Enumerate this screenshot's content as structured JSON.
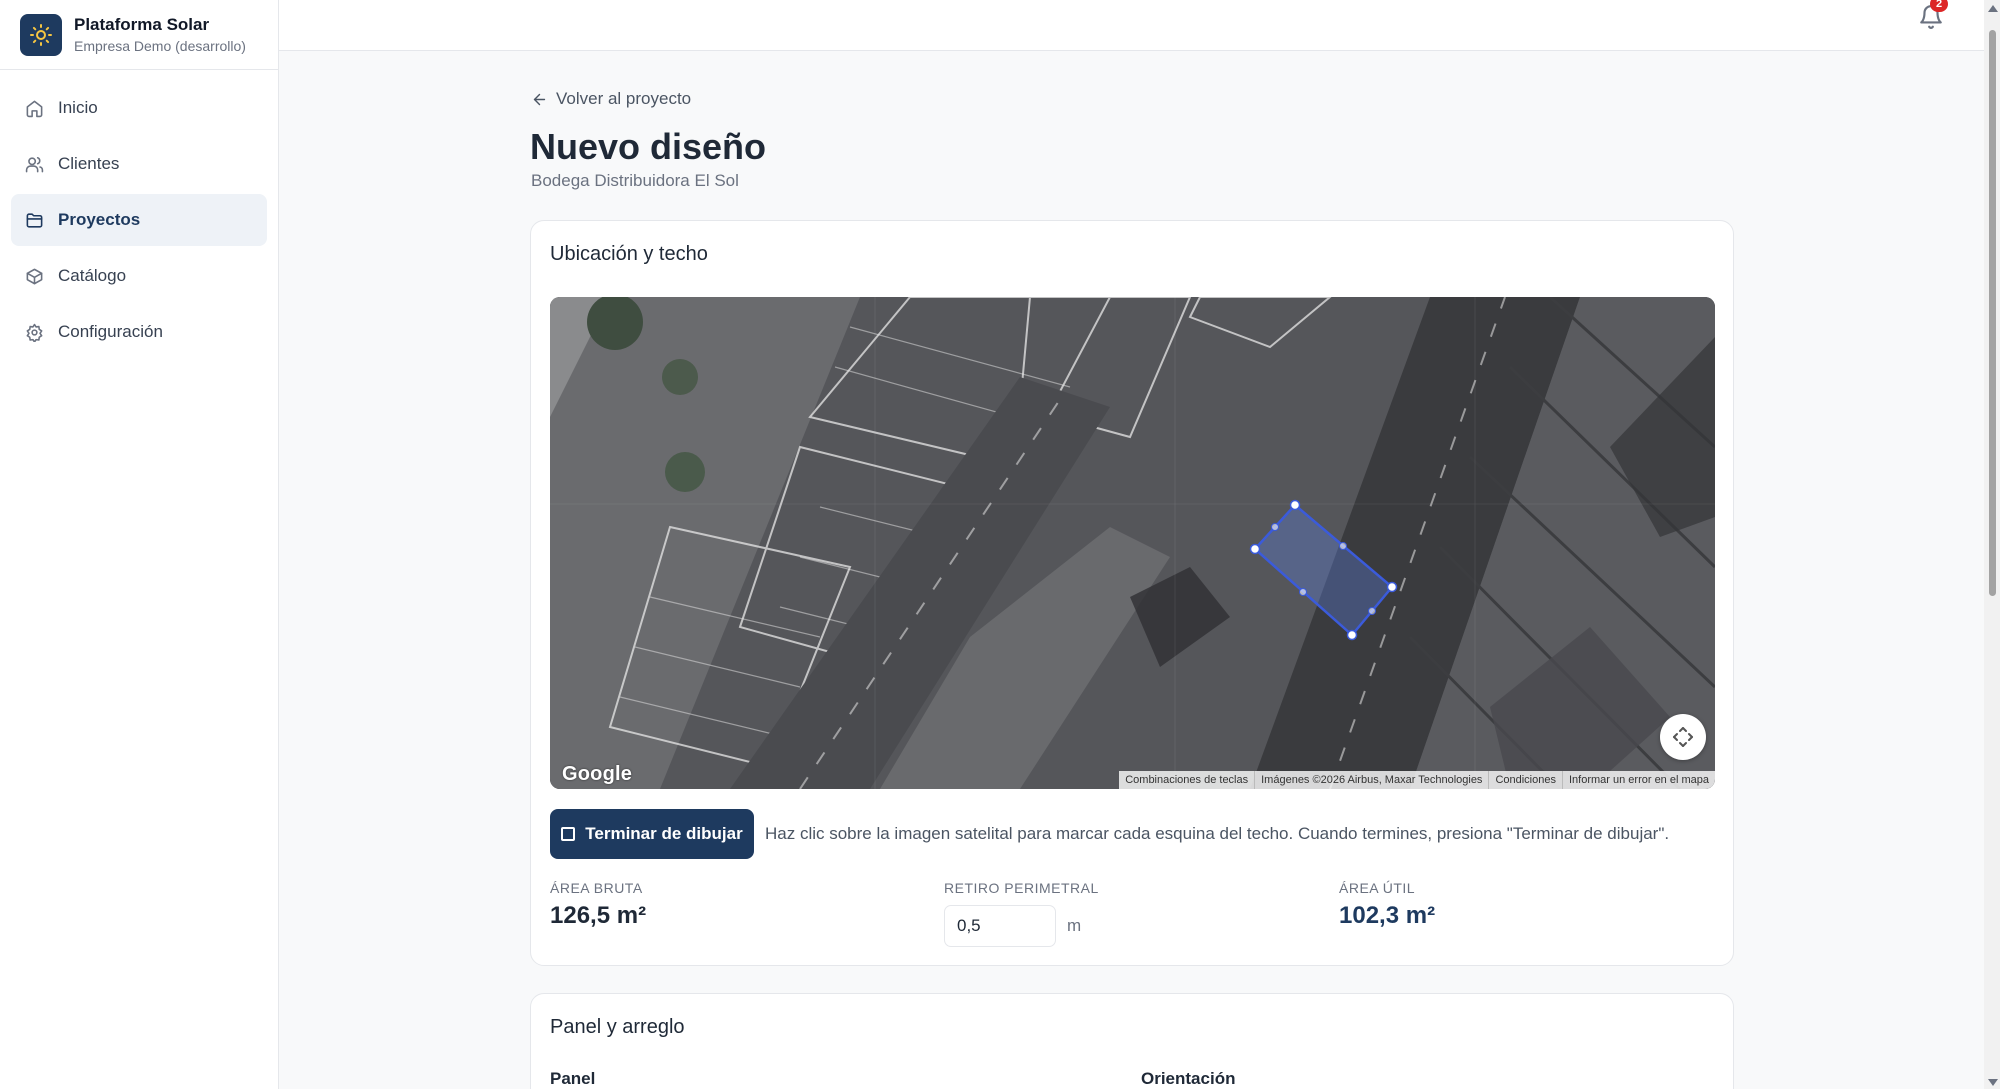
{
  "brand": {
    "title": "Plataforma Solar",
    "subtitle": "Empresa Demo (desarrollo)"
  },
  "nav": {
    "items": [
      {
        "label": "Inicio",
        "icon": "home-icon"
      },
      {
        "label": "Clientes",
        "icon": "users-icon"
      },
      {
        "label": "Proyectos",
        "icon": "folder-icon",
        "active": true
      },
      {
        "label": "Catálogo",
        "icon": "package-icon"
      },
      {
        "label": "Configuración",
        "icon": "gear-icon"
      }
    ]
  },
  "topbar": {
    "notification_count": "2"
  },
  "page": {
    "back_label": "Volver al proyecto",
    "title": "Nuevo diseño",
    "subtitle": "Bodega Distribuidora El Sol"
  },
  "location_card": {
    "title": "Ubicación y techo",
    "map": {
      "google_label": "Google",
      "attribution": [
        "Combinaciones de teclas",
        "Imágenes ©2026 Airbus, Maxar Technologies",
        "Condiciones",
        "Informar un error en el mapa"
      ]
    },
    "finish_button": "Terminar de dibujar",
    "hint": "Haz clic sobre la imagen satelital para marcar cada esquina del techo. Cuando termines, presiona \"Terminar de dibujar\".",
    "gross_area": {
      "label": "ÁREA BRUTA",
      "value": "126,5 m²"
    },
    "setback": {
      "label": "RETIRO PERIMETRAL",
      "value": "0,5",
      "unit": "m"
    },
    "usable_area": {
      "label": "ÁREA ÚTIL",
      "value": "102,3 m²"
    }
  },
  "panel_card": {
    "title": "Panel y arreglo",
    "panel_label": "Panel",
    "orientation_label": "Orientación"
  },
  "colors": {
    "primary": "#1e3a5f",
    "polygon": "#3b5bdb",
    "badge": "#dc2626"
  }
}
